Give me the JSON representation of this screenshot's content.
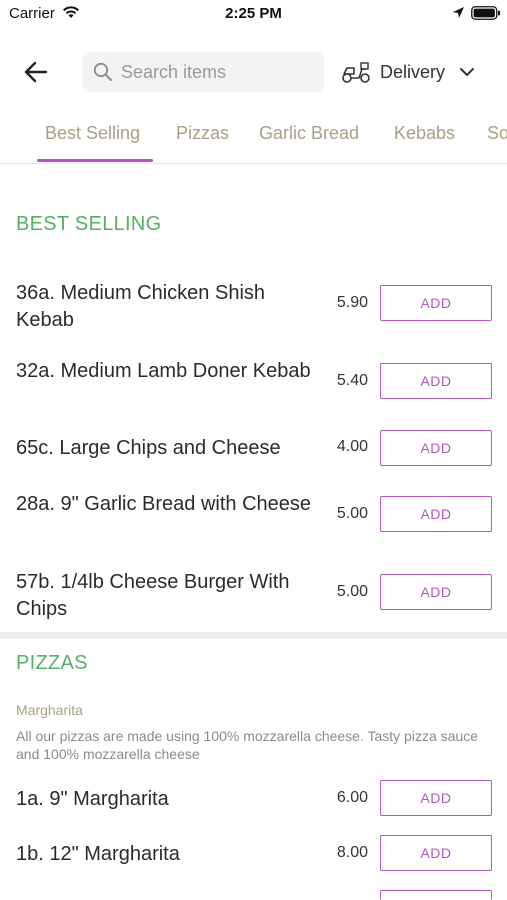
{
  "status_bar": {
    "carrier": "Carrier",
    "time": "2:25 PM"
  },
  "top_bar": {
    "search_placeholder": "Search items",
    "delivery_label": "Delivery"
  },
  "tabs": [
    {
      "label": "Best Selling",
      "active": true
    },
    {
      "label": "Pizzas",
      "active": false
    },
    {
      "label": "Garlic Bread",
      "active": false
    },
    {
      "label": "Kebabs",
      "active": false
    },
    {
      "label": "So",
      "active": false
    }
  ],
  "sections": {
    "best_selling": {
      "heading": "BEST SELLING",
      "items": [
        {
          "name": "36a. Medium Chicken Shish Kebab",
          "price": "5.90",
          "button": "ADD"
        },
        {
          "name": "32a. Medium Lamb Doner Kebab",
          "price": "5.40",
          "button": "ADD"
        },
        {
          "name": "65c. Large Chips and Cheese",
          "price": "4.00",
          "button": "ADD"
        },
        {
          "name": "28a. 9\" Garlic Bread with Cheese",
          "price": "5.00",
          "button": "ADD"
        },
        {
          "name": "57b. 1/4lb Cheese Burger With Chips",
          "price": "5.00",
          "button": "ADD"
        }
      ]
    },
    "pizzas": {
      "heading": "PIZZAS",
      "subheading": "Margharita",
      "description": "All our pizzas are made using 100% mozzarella cheese. Tasty pizza sauce and 100% mozzarella cheese",
      "items": [
        {
          "name": "1a. 9\" Margharita",
          "price": "6.00",
          "button": "ADD"
        },
        {
          "name": "1b. 12\" Margharita",
          "price": "8.00",
          "button": "ADD"
        }
      ]
    }
  },
  "colors": {
    "accent": "#b157c2",
    "section_heading": "#55b066",
    "tab_text": "#a89f85"
  },
  "icons": [
    "wifi-icon",
    "location-arrow-icon",
    "battery-icon",
    "back-arrow-icon",
    "search-icon",
    "scooter-icon",
    "chevron-down-icon"
  ]
}
